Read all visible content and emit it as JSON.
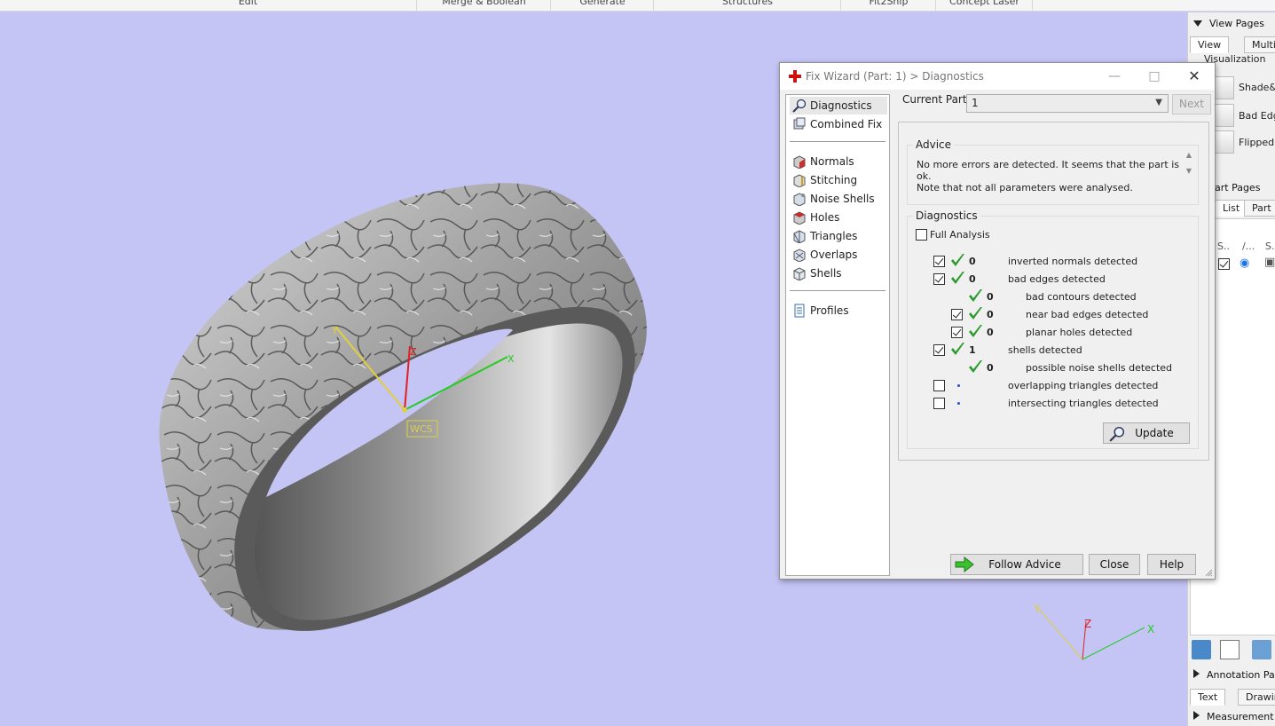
{
  "ribbon": {
    "groups": [
      "Edit",
      "Merge & Boolean",
      "Generate",
      "Structures",
      "Fit2Ship",
      "Concept Laser"
    ]
  },
  "viewport": {
    "wcs_label": "WCS",
    "axis_x": "X",
    "axis_y": "Y",
    "axis_z": "Z",
    "colors": {
      "background": "#c4c4f5",
      "x_axis": "#22cc22",
      "y_axis": "#e0d040",
      "z_axis": "#e02020"
    }
  },
  "right_panel": {
    "view_pages_header": "View Pages",
    "tabs": [
      "View",
      "Multi-S"
    ],
    "visualization_label": "Visualization",
    "vis_items": [
      "Shade&W",
      "Bad Edge",
      "Flipped T"
    ],
    "part_pages_header": "art Pages",
    "part_tabs": [
      "List",
      "Part I"
    ],
    "col_headers": [
      "S..",
      "/...",
      "S.."
    ],
    "annotation_header": "Annotation Pag",
    "annotation_tabs": [
      "Text",
      "Drawin"
    ],
    "measurement_header": "Measurement P"
  },
  "dialog": {
    "title": "Fix Wizard (Part: 1) > Diagnostics",
    "nav": {
      "top": [
        {
          "label": "Diagnostics",
          "icon": "magnifier-icon",
          "selected": true
        },
        {
          "label": "Combined Fix",
          "icon": "cubes-icon",
          "selected": false
        }
      ],
      "fix": [
        {
          "label": "Normals",
          "icon": "normals-cube-icon"
        },
        {
          "label": "Stitching",
          "icon": "stitching-cube-icon"
        },
        {
          "label": "Noise Shells",
          "icon": "noise-shells-cube-icon"
        },
        {
          "label": "Holes",
          "icon": "holes-cube-icon"
        },
        {
          "label": "Triangles",
          "icon": "triangles-cube-icon"
        },
        {
          "label": "Overlaps",
          "icon": "overlaps-cube-icon"
        },
        {
          "label": "Shells",
          "icon": "shells-cube-icon"
        }
      ],
      "bottom": [
        {
          "label": "Profiles",
          "icon": "document-icon"
        }
      ]
    },
    "current_part_label": "Current Part:",
    "current_part_value": "1",
    "next_label": "Next",
    "advice": {
      "title": "Advice",
      "lines": [
        "No more errors are detected. It seems that the part is ok.",
        "Note that not all parameters were analysed."
      ]
    },
    "diagnostics": {
      "title": "Diagnostics",
      "full_analysis_label": "Full Analysis",
      "full_analysis_checked": false,
      "rows": [
        {
          "checkbox": true,
          "checked": true,
          "status": "ok",
          "count": "0",
          "text": "inverted normals detected",
          "indent": 0
        },
        {
          "checkbox": true,
          "checked": true,
          "status": "ok",
          "count": "0",
          "text": "bad edges detected",
          "indent": 0
        },
        {
          "checkbox": false,
          "checked": false,
          "status": "ok",
          "count": "0",
          "text": "bad contours detected",
          "indent": 1
        },
        {
          "checkbox": true,
          "checked": true,
          "status": "ok",
          "count": "0",
          "text": "near bad edges detected",
          "indent": 1
        },
        {
          "checkbox": true,
          "checked": true,
          "status": "ok",
          "count": "0",
          "text": "planar holes detected",
          "indent": 1
        },
        {
          "checkbox": true,
          "checked": true,
          "status": "ok",
          "count": "1",
          "text": "shells detected",
          "indent": 0
        },
        {
          "checkbox": false,
          "checked": false,
          "status": "ok",
          "count": "0",
          "text": "possible noise shells detected",
          "indent": 1
        },
        {
          "checkbox": true,
          "checked": false,
          "status": "dot",
          "count": "",
          "text": "overlapping triangles detected",
          "indent": 0
        },
        {
          "checkbox": true,
          "checked": false,
          "status": "dot",
          "count": "",
          "text": "intersecting triangles detected",
          "indent": 0
        }
      ],
      "update_label": "Update"
    },
    "buttons": {
      "follow_advice": "Follow Advice",
      "close": "Close",
      "help": "Help"
    }
  }
}
